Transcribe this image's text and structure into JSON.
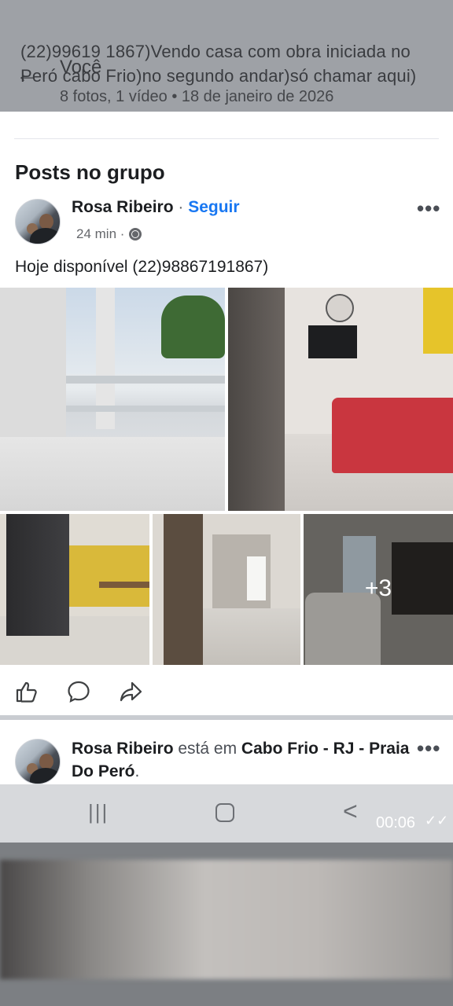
{
  "header": {
    "message": "(22)99619 1867)Vendo casa com obra iniciada no Peró cabo Frio)no segundo andar)só chamar aqui)",
    "back_label": "Você",
    "meta": "8 fotos, 1 vídeo  •  18 de janeiro de 2026"
  },
  "section": {
    "title": "Posts no grupo"
  },
  "post1": {
    "author": "Rosa Ribeiro",
    "separator": " · ",
    "follow": "Seguir",
    "time": "24 min ·",
    "text": "Hoje disponível (22)98867191867)",
    "more_photos": "+3",
    "more_icon": "•••"
  },
  "post2": {
    "author": "Rosa Ribeiro",
    "verb": "está em",
    "place": "Cabo Frio - RJ - Praia Do Peró",
    "period": ".",
    "more_icon": "•••"
  },
  "navbar": {
    "recent_icon": "|||",
    "back_icon": "<",
    "clock": "00:06",
    "read_icon": "✓✓"
  }
}
